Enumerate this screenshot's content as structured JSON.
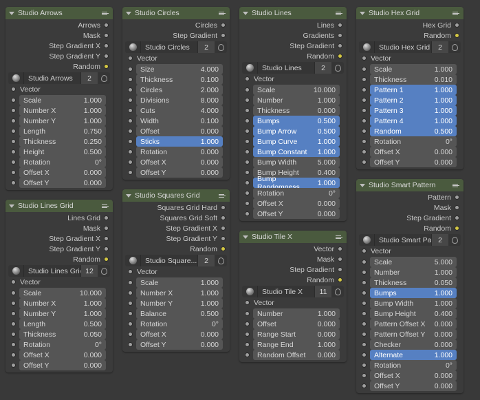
{
  "nodes": {
    "arrows": {
      "title": "Studio Arrows",
      "outputs": [
        "Arrows",
        "Mask",
        "Step Gradient X",
        "Step Gradient Y",
        "Random"
      ],
      "widget": {
        "name": "Studio Arrows",
        "count": "2"
      },
      "vector": "Vector",
      "params": [
        {
          "n": "Scale",
          "v": "1.000"
        },
        {
          "n": "Number X",
          "v": "1.000"
        },
        {
          "n": "Number Y",
          "v": "1.000"
        },
        {
          "n": "Length",
          "v": "0.750"
        },
        {
          "n": "Thickness",
          "v": "0.250"
        },
        {
          "n": "Height",
          "v": "0.500"
        },
        {
          "n": "Rotation",
          "v": "0°"
        },
        {
          "n": "Offset X",
          "v": "0.000"
        },
        {
          "n": "Offset Y",
          "v": "0.000"
        }
      ]
    },
    "linesgrid": {
      "title": "Studio Lines Grid",
      "outputs": [
        "Lines Grid",
        "Mask",
        "Step Gradient X",
        "Step Gradient Y",
        "Random"
      ],
      "widget": {
        "name": "Studio Lines Grid",
        "count": "12"
      },
      "vector": "Vector",
      "params": [
        {
          "n": "Scale",
          "v": "10.000"
        },
        {
          "n": "Number X",
          "v": "1.000"
        },
        {
          "n": "Number Y",
          "v": "1.000"
        },
        {
          "n": "Length",
          "v": "0.500"
        },
        {
          "n": "Thickness",
          "v": "0.050"
        },
        {
          "n": "Rotation",
          "v": "0°"
        },
        {
          "n": "Offset X",
          "v": "0.000"
        },
        {
          "n": "Offset Y",
          "v": "0.000"
        }
      ]
    },
    "circles": {
      "title": "Studio Circles",
      "outputs": [
        "Circles",
        "Step Gradient"
      ],
      "widget": {
        "name": "Studio Circles",
        "count": "2"
      },
      "vector": "Vector",
      "params": [
        {
          "n": "Size",
          "v": "4.000"
        },
        {
          "n": "Thickness",
          "v": "0.100"
        },
        {
          "n": "Circles",
          "v": "2.000"
        },
        {
          "n": "Divisions",
          "v": "8.000"
        },
        {
          "n": "Cuts",
          "v": "4.000"
        },
        {
          "n": "Width",
          "v": "0.100"
        },
        {
          "n": "Offset",
          "v": "0.000"
        },
        {
          "n": "Sticks",
          "v": "1.000",
          "hl": true
        },
        {
          "n": "Rotation",
          "v": "0.000"
        },
        {
          "n": "Offset X",
          "v": "0.000"
        },
        {
          "n": "Offset Y",
          "v": "0.000"
        }
      ]
    },
    "squares": {
      "title": "Studio Squares Grid",
      "outputs": [
        "Squares Grid Hard",
        "Squares Grid Soft",
        "Step Gradient X",
        "Step Gradient Y",
        "Random"
      ],
      "widget": {
        "name": "Studio Square...",
        "count": "2"
      },
      "vector": "Vector",
      "params": [
        {
          "n": "Scale",
          "v": "1.000"
        },
        {
          "n": "Number X",
          "v": "1.000"
        },
        {
          "n": "Number Y",
          "v": "1.000"
        },
        {
          "n": "Balance",
          "v": "0.500"
        },
        {
          "n": "Rotation",
          "v": "0°"
        },
        {
          "n": "Offset X",
          "v": "0.000"
        },
        {
          "n": "Offset Y",
          "v": "0.000"
        }
      ]
    },
    "lines": {
      "title": "Studio Lines",
      "outputs": [
        "Lines",
        "Gradients",
        "Step Gradient",
        "Random"
      ],
      "widget": {
        "name": "Studio Lines",
        "count": "2"
      },
      "vector": "Vector",
      "params": [
        {
          "n": "Scale",
          "v": "10.000"
        },
        {
          "n": "Number",
          "v": "1.000"
        },
        {
          "n": "Thickness",
          "v": "0.000"
        },
        {
          "n": "Bumps",
          "v": "0.500",
          "hl": true
        },
        {
          "n": "Bump Arrow",
          "v": "0.500",
          "hl": true
        },
        {
          "n": "Bump Curve",
          "v": "1.000",
          "hl": true
        },
        {
          "n": "Bump Constant",
          "v": "1.000",
          "hl": true
        },
        {
          "n": "Bump Width",
          "v": "5.000"
        },
        {
          "n": "Bump Height",
          "v": "0.400"
        },
        {
          "n": "Bump Randomness",
          "v": "1.000",
          "hl": true
        },
        {
          "n": "Rotation",
          "v": "0°"
        },
        {
          "n": "Offset X",
          "v": "0.000"
        },
        {
          "n": "Offset Y",
          "v": "0.000"
        }
      ]
    },
    "tilex": {
      "title": "Studio Tile X",
      "outputs": [
        "Vector",
        "Mask",
        "Step Gradient",
        "Random"
      ],
      "widget": {
        "name": "Studio Tile X",
        "count": "11"
      },
      "vector": "Vector",
      "params": [
        {
          "n": "Number",
          "v": "1.000"
        },
        {
          "n": "Offset",
          "v": "0.000"
        },
        {
          "n": "Range Start",
          "v": "0.000"
        },
        {
          "n": "Range End",
          "v": "1.000"
        },
        {
          "n": "Random Offset",
          "v": "0.000"
        }
      ]
    },
    "hexgrid": {
      "title": "Studio Hex Grid",
      "outputs": [
        "Hex Grid",
        "Random"
      ],
      "widget": {
        "name": "Studio Hex Grid",
        "count": "2"
      },
      "vector": "Vector",
      "params": [
        {
          "n": "Scale",
          "v": "1.000"
        },
        {
          "n": "Thickness",
          "v": "0.010"
        },
        {
          "n": "Pattern 1",
          "v": "1.000",
          "hl": true
        },
        {
          "n": "Pattern 2",
          "v": "1.000",
          "hl": true
        },
        {
          "n": "Pattern 3",
          "v": "1.000",
          "hl": true
        },
        {
          "n": "Pattern 4",
          "v": "1.000",
          "hl": true
        },
        {
          "n": "Random",
          "v": "0.500",
          "hl": true
        },
        {
          "n": "Rotation",
          "v": "0°"
        },
        {
          "n": "Offset X",
          "v": "0.000"
        },
        {
          "n": "Offset Y",
          "v": "0.000"
        }
      ]
    },
    "smart": {
      "title": "Studio Smart Pattern",
      "outputs": [
        "Pattern",
        "Mask",
        "Step Gradient",
        "Random"
      ],
      "widget": {
        "name": "Studio Smart Patte...",
        "count": "2"
      },
      "vector": "Vector",
      "params": [
        {
          "n": "Scale",
          "v": "5.000"
        },
        {
          "n": "Number",
          "v": "1.000"
        },
        {
          "n": "Thickness",
          "v": "0.050"
        },
        {
          "n": "Bumps",
          "v": "1.000",
          "hl": true
        },
        {
          "n": "Bump Width",
          "v": "1.000"
        },
        {
          "n": "Bump Height",
          "v": "0.400"
        },
        {
          "n": "Pattern Offset X",
          "v": "0.000"
        },
        {
          "n": "Pattern Offset Y",
          "v": "0.000"
        },
        {
          "n": "Checker",
          "v": "0.000"
        },
        {
          "n": "Alternate",
          "v": "1.000",
          "hl": true
        },
        {
          "n": "Rotation",
          "v": "0°"
        },
        {
          "n": "Offset X",
          "v": "0.000"
        },
        {
          "n": "Offset Y",
          "v": "0.000"
        }
      ]
    }
  }
}
